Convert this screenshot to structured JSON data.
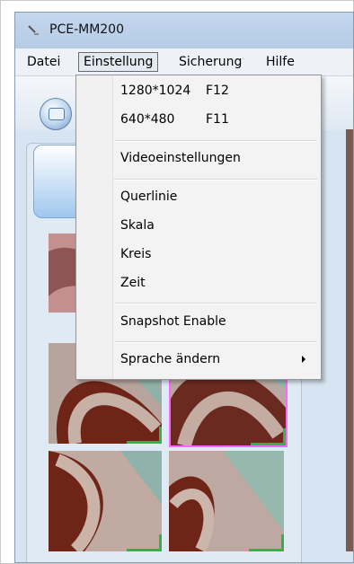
{
  "window": {
    "title": "PCE-MM200"
  },
  "menubar": {
    "items": [
      {
        "label": "Datei"
      },
      {
        "label": "Einstellung"
      },
      {
        "label": "Sicherung"
      },
      {
        "label": "Hilfe"
      }
    ]
  },
  "dropdown": {
    "res_high_label": "1280*1024",
    "res_high_shortcut": "F12",
    "res_low_label": "640*480",
    "res_low_shortcut": "F11",
    "video_settings": "Videoeinstellungen",
    "crossline": "Querlinie",
    "scale": "Skala",
    "circle": "Kreis",
    "time": "Zeit",
    "snapshot_enable": "Snapshot Enable",
    "change_language": "Sprache ändern"
  },
  "icons": {
    "app": "microscope-icon",
    "camera": "camera-icon",
    "submenu": "chevron-right-icon"
  },
  "colors": {
    "selection_border": "#ff66ff",
    "thumbnail_corner": "#2fb34a",
    "toolbar_blue": "#2d63b0"
  }
}
